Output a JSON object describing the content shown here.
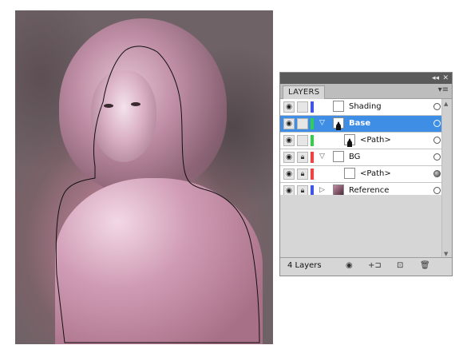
{
  "panel": {
    "tab_label": "LAYERS",
    "collapse_glyph": "◂◂",
    "close_glyph": "✕",
    "menu_glyph": "▾≡",
    "layers": [
      {
        "name": "Shading",
        "color": "#3a52ff",
        "selected": false,
        "indent": false,
        "twirl": "",
        "eye": true,
        "lock": false
      },
      {
        "name": "Base",
        "color": "#2fd04a",
        "selected": true,
        "indent": false,
        "twirl": "▽",
        "eye": true,
        "lock": false
      },
      {
        "name": "<Path>",
        "color": "#2fd04a",
        "selected": false,
        "indent": true,
        "twirl": "",
        "eye": true,
        "lock": false
      },
      {
        "name": "BG",
        "color": "#ff3b3b",
        "selected": false,
        "indent": false,
        "twirl": "▽",
        "eye": true,
        "lock": true
      },
      {
        "name": "<Path>",
        "color": "#ff3b3b",
        "selected": false,
        "indent": true,
        "twirl": "",
        "eye": true,
        "lock": true
      },
      {
        "name": "Reference",
        "color": "#3a52ff",
        "selected": false,
        "indent": false,
        "twirl": "▷",
        "eye": true,
        "lock": true
      }
    ],
    "footer": {
      "count_label": "4 Layers",
      "buttons": [
        {
          "icon": "make-clipping-mask-icon",
          "glyph": "◉"
        },
        {
          "icon": "create-sublayer-icon",
          "glyph": "+⊐"
        },
        {
          "icon": "new-layer-icon",
          "glyph": "⊡"
        },
        {
          "icon": "trash-icon",
          "glyph": "🗑"
        }
      ]
    }
  },
  "colors": {
    "selection": "#3e8ee5",
    "panel_bg": "#d6d6d6",
    "topbar": "#5a5a5a"
  }
}
